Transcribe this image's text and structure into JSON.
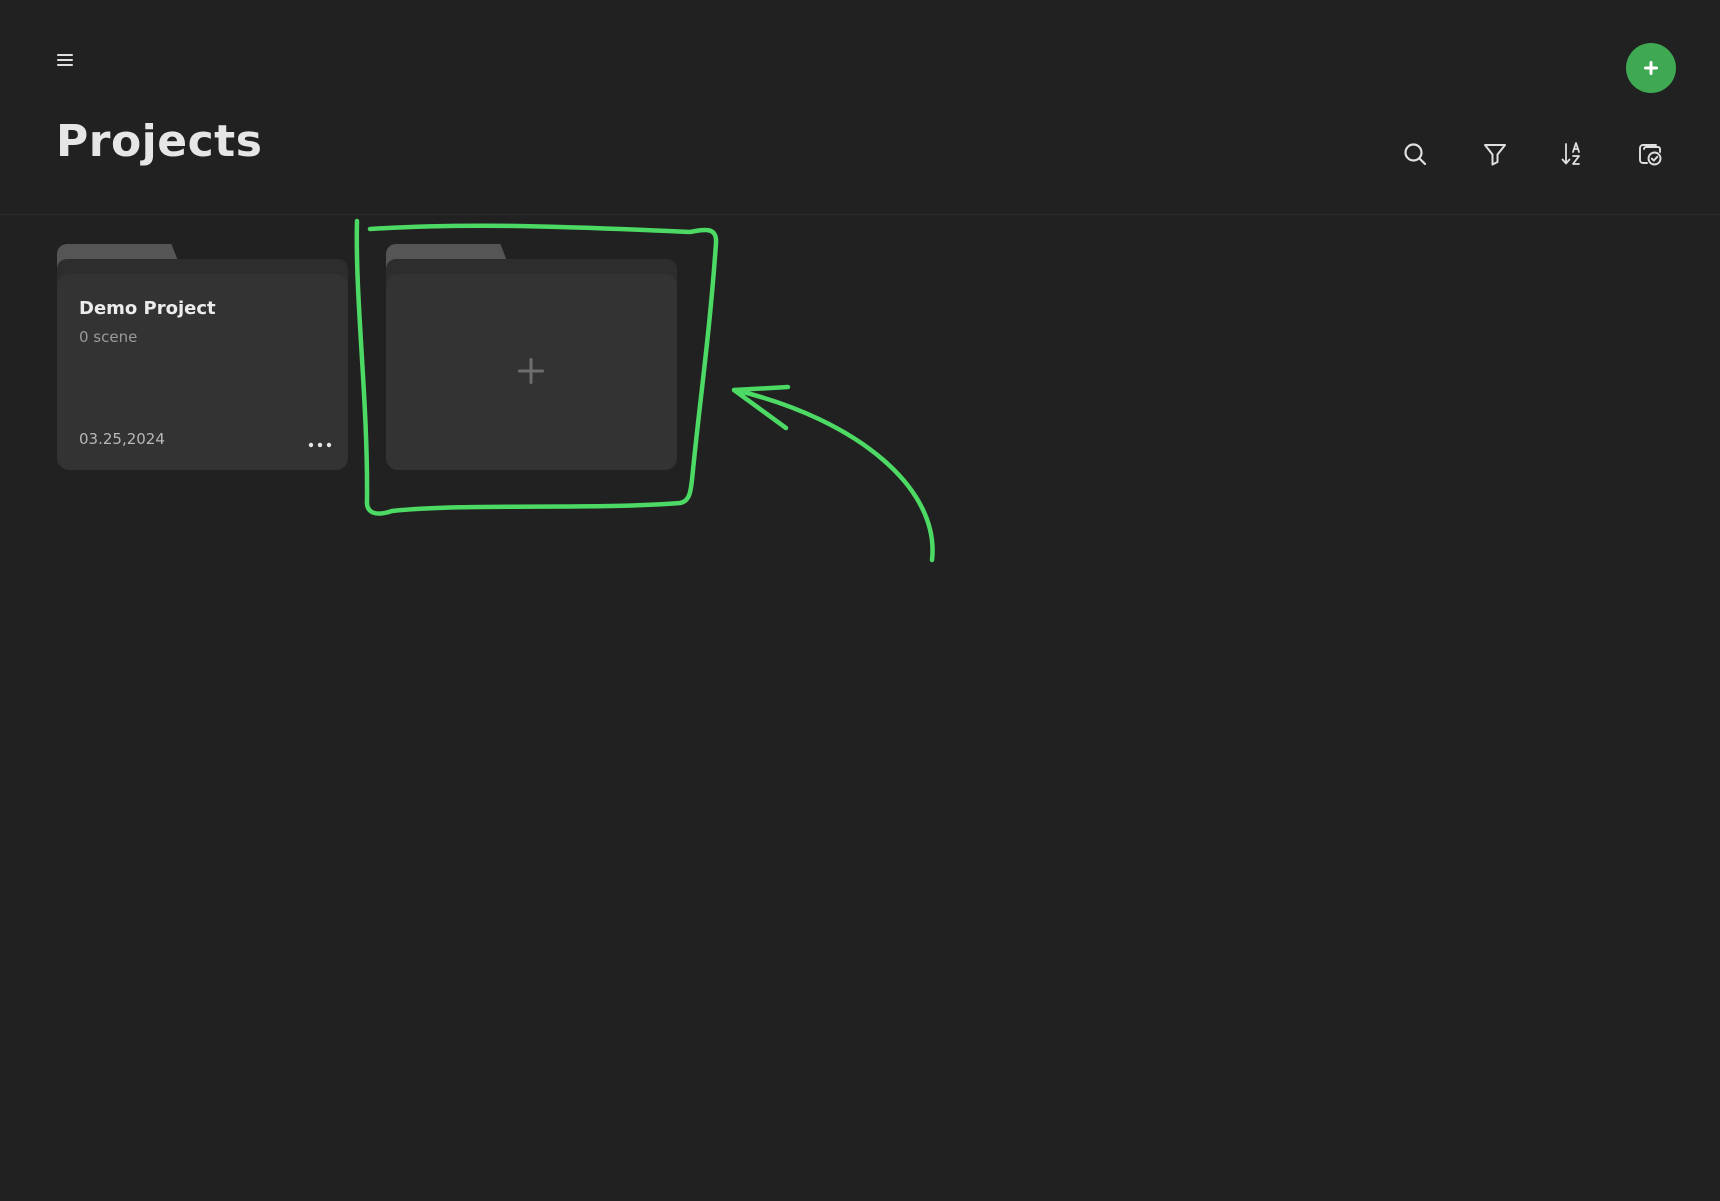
{
  "header": {
    "title": "Projects",
    "menu_icon": "hamburger-menu-icon",
    "fab_icon": "plus-icon",
    "accent_color": "#3fa853"
  },
  "toolbar": {
    "icons": [
      "search-icon",
      "filter-icon",
      "sort-az-icon",
      "select-icon"
    ]
  },
  "projects": [
    {
      "name": "Demo Project",
      "scenes": "0 scene",
      "date": "03.25,2024",
      "more_icon": "more-horizontal-icon"
    }
  ],
  "new_project_card": {
    "icon": "plus-icon"
  },
  "annotation": {
    "color": "#4cd964"
  }
}
